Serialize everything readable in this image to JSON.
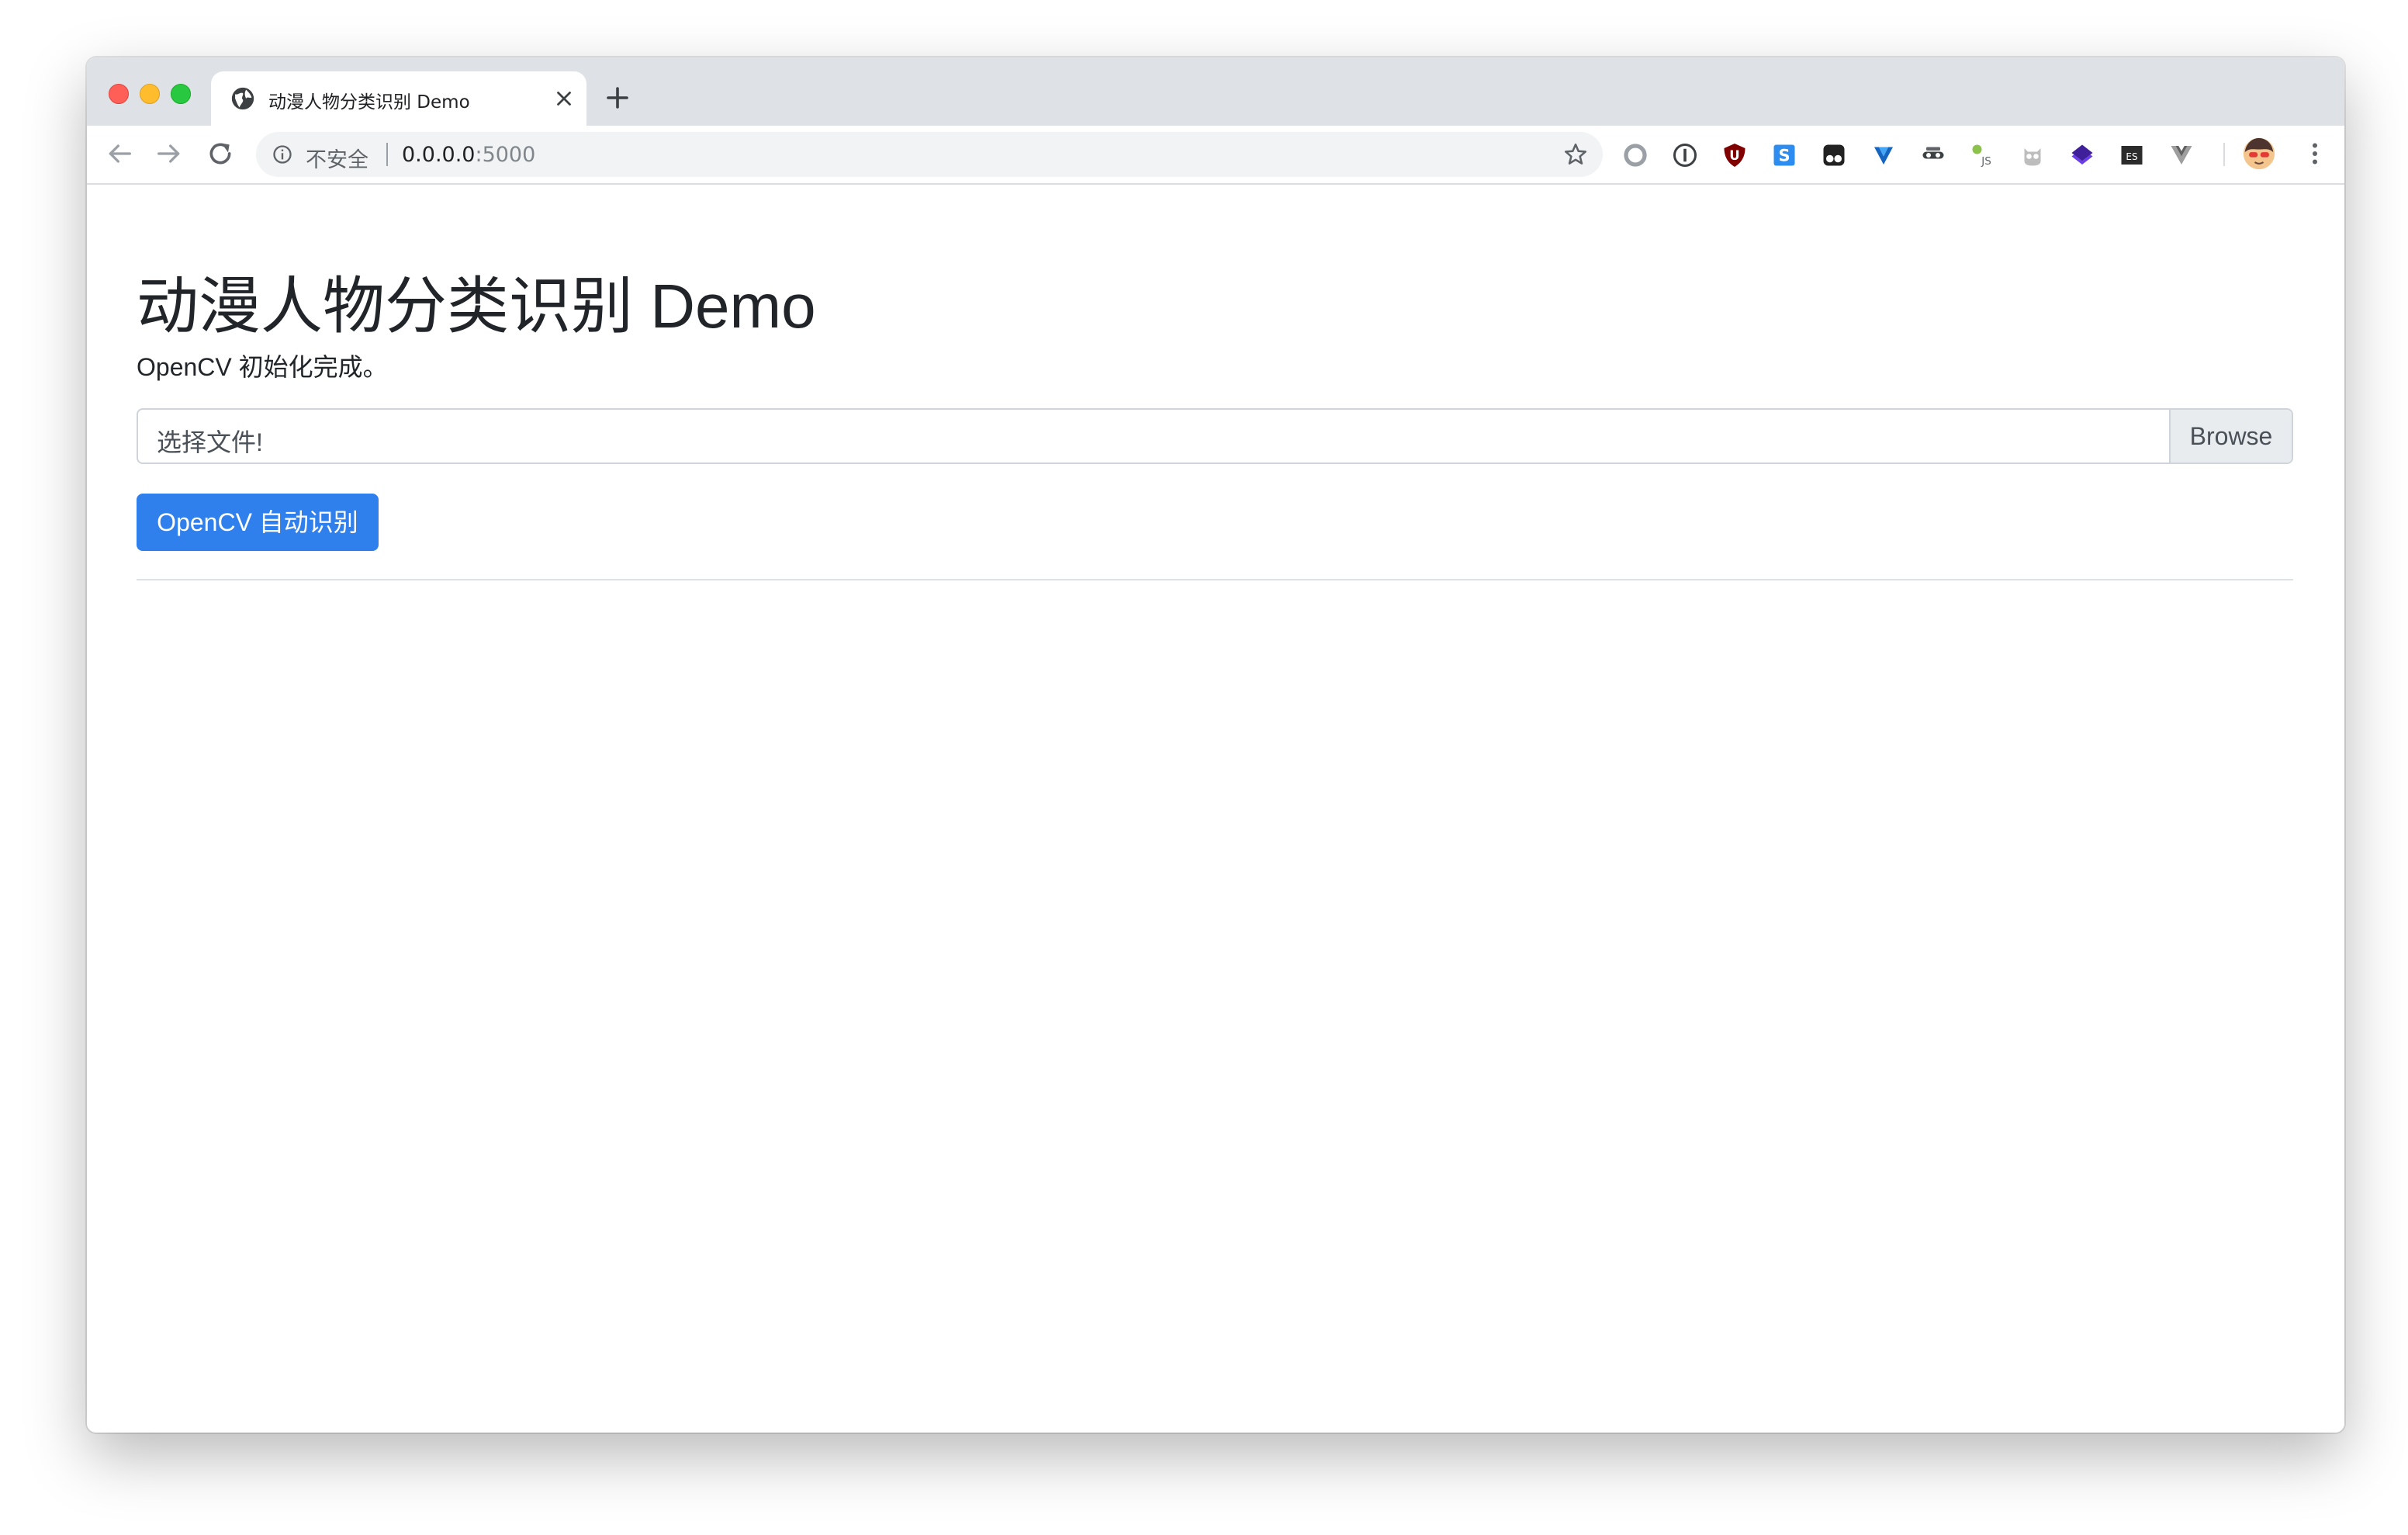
{
  "browser": {
    "tab_title": "动漫人物分类识别 Demo",
    "security_label": "不安全",
    "url_host": "0.0.0.0",
    "url_port": ":5000",
    "extensions": [
      {
        "name": "circle-extension-icon",
        "label": ""
      },
      {
        "name": "1password-extension-icon",
        "label": ""
      },
      {
        "name": "ublock-extension-icon",
        "label": "U"
      },
      {
        "name": "s-extension-icon",
        "label": "S"
      },
      {
        "name": "tampermonkey-extension-icon",
        "label": ""
      },
      {
        "name": "v-extension-icon",
        "label": "V"
      },
      {
        "name": "incognito-extension-icon",
        "label": ""
      },
      {
        "name": "js-extension-icon",
        "label": "JS"
      },
      {
        "name": "owl-extension-icon",
        "label": ""
      },
      {
        "name": "layers-extension-icon",
        "label": ""
      },
      {
        "name": "es-extension-icon",
        "label": "ES"
      },
      {
        "name": "vue-extension-icon",
        "label": ""
      }
    ]
  },
  "page": {
    "title": "动漫人物分类识别 Demo",
    "status": "OpenCV 初始化完成。",
    "file_input": {
      "label": "选择文件!",
      "browse_label": "Browse"
    },
    "detect_button_label": "OpenCV 自动识别"
  },
  "colors": {
    "primary": "#2f80ed",
    "text": "#212529",
    "tabbar": "#dee1e6"
  }
}
